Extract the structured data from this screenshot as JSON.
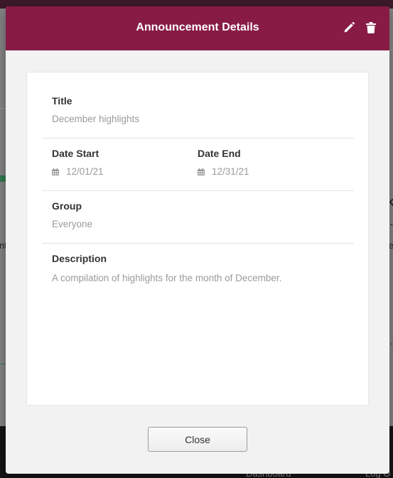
{
  "background": {
    "left_fragment": "nt",
    "right_fragments": [
      "K",
      "-",
      "e",
      "."
    ],
    "footer_links": [
      "Dashboard",
      "Log O"
    ]
  },
  "modal": {
    "title": "Announcement Details",
    "header_color": "#871b46",
    "header_icons": {
      "edit": "pencil-icon",
      "delete": "trash-icon"
    },
    "fields": {
      "title": {
        "label": "Title",
        "value": "December highlights"
      },
      "date_start": {
        "label": "Date Start",
        "value": "12/01/21",
        "icon": "calendar-icon"
      },
      "date_end": {
        "label": "Date End",
        "value": "12/31/21",
        "icon": "calendar-icon"
      },
      "group": {
        "label": "Group",
        "value": "Everyone"
      },
      "description": {
        "label": "Description",
        "value": "A compilation of highlights for the month of December."
      }
    },
    "close_label": "Close"
  }
}
